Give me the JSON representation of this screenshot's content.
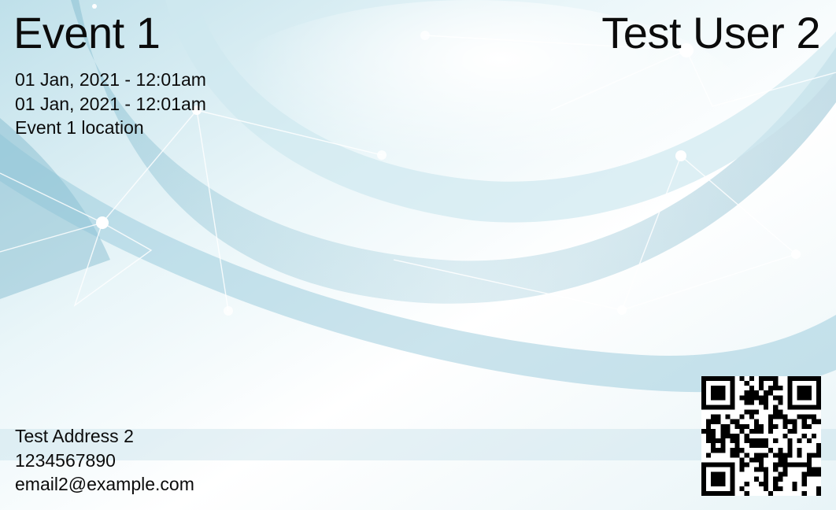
{
  "event": {
    "title": "Event 1",
    "start": "01 Jan, 2021 - 12:01am",
    "end": "01 Jan, 2021 - 12:01am",
    "location": "Event 1 location"
  },
  "attendee": {
    "name": "Test User 2",
    "address": "Test Address 2",
    "phone": "1234567890",
    "email": "email2@example.com"
  },
  "colors": {
    "text": "#0b0b0b",
    "background_accent": "#6fb3c9"
  },
  "icons": {
    "qr": "qr-code-icon"
  }
}
